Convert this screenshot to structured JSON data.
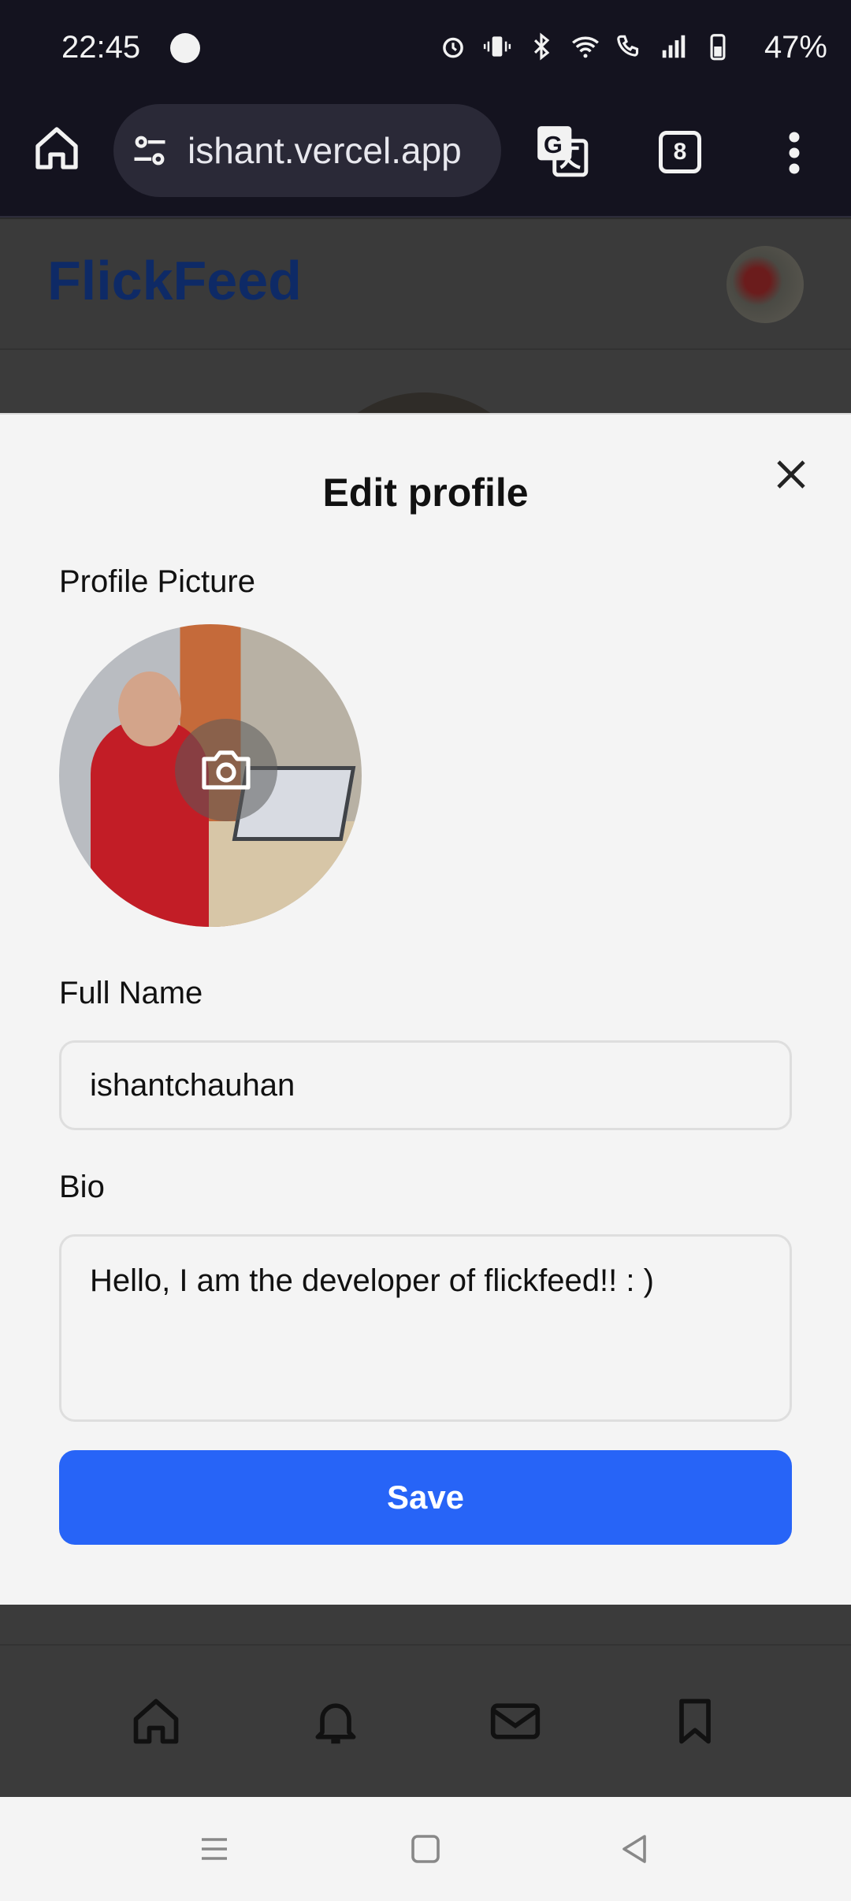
{
  "status_bar": {
    "time": "22:45",
    "battery": "47%",
    "icons": [
      "alarm-icon",
      "vibrate-icon",
      "bluetooth-icon",
      "wifi-icon",
      "wifi-calling-icon",
      "signal-icon",
      "battery-icon"
    ]
  },
  "browser": {
    "url": "ishant.vercel.app",
    "tab_count": "8"
  },
  "app": {
    "brand": "FlickFeed"
  },
  "modal": {
    "title": "Edit profile",
    "profile_picture_label": "Profile Picture",
    "full_name_label": "Full Name",
    "full_name_value": "ishantchauhan",
    "bio_label": "Bio",
    "bio_value": "Hello, I am the developer of flickfeed!! : )",
    "save_label": "Save"
  },
  "bottom_nav": {
    "items": [
      "home-icon",
      "bell-icon",
      "mail-icon",
      "bookmark-icon"
    ]
  },
  "colors": {
    "accent": "#2764f7",
    "brand": "#0e2a66",
    "status_bg": "#14131f"
  }
}
